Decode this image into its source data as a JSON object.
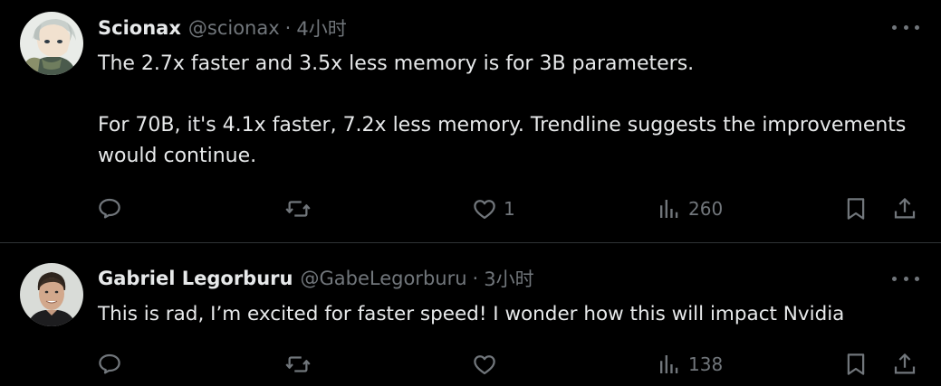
{
  "colors": {
    "background": "#000000",
    "text_primary": "#e7e9ea",
    "text_secondary": "#71767b",
    "divider": "#2f3336"
  },
  "tweets": [
    {
      "name": "Scionax",
      "handle": "@scionax",
      "separator": "·",
      "time": "4小时",
      "text": "The 2.7x faster and 3.5x less memory is for 3B parameters.\n\nFor 70B, it's 4.1x faster, 7.2x less memory. Trendline suggests the improvements would continue.",
      "metrics": {
        "likes": "1",
        "views": "260"
      },
      "icons": [
        "reply-icon",
        "repost-icon",
        "like-icon",
        "views-icon",
        "bookmark-icon",
        "share-icon"
      ]
    },
    {
      "name": "Gabriel Legorburu",
      "handle": "@GabeLegorburu",
      "separator": "·",
      "time": "3小时",
      "text": "This is rad, I’m excited for faster speed! I wonder how this will impact Nvidia",
      "metrics": {
        "likes": "",
        "views": "138"
      },
      "icons": [
        "reply-icon",
        "repost-icon",
        "like-icon",
        "views-icon",
        "bookmark-icon",
        "share-icon"
      ]
    }
  ]
}
